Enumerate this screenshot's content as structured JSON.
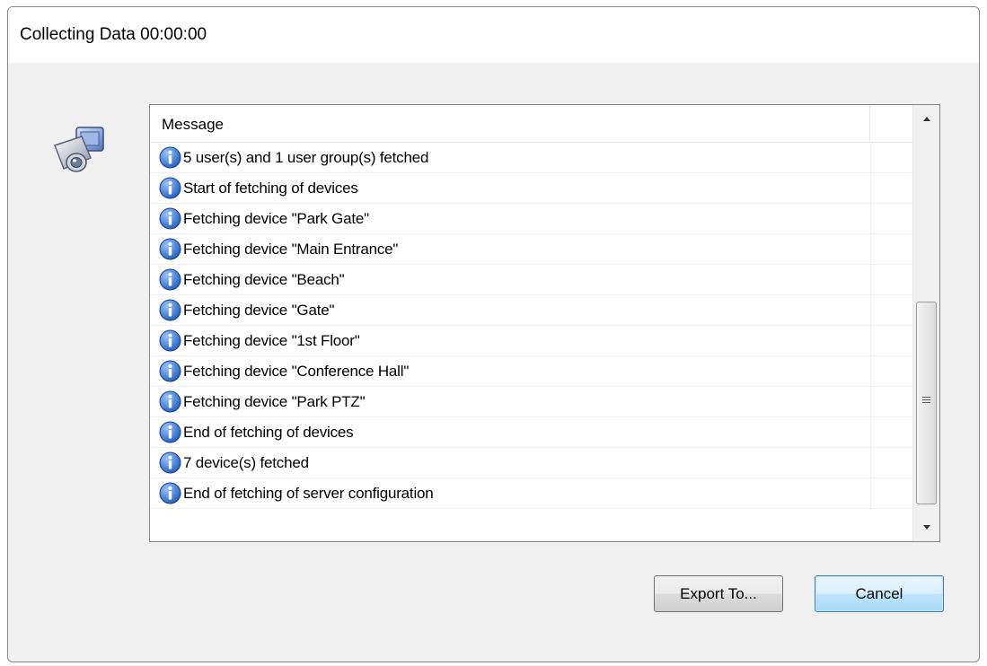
{
  "window": {
    "title": "Collecting Data 00:00:00"
  },
  "list": {
    "column_header": "Message",
    "rows": [
      {
        "icon": "info-icon",
        "text": "5 user(s) and 1 user group(s) fetched"
      },
      {
        "icon": "info-icon",
        "text": "Start of fetching of devices"
      },
      {
        "icon": "info-icon",
        "text": "Fetching device \"Park Gate\""
      },
      {
        "icon": "info-icon",
        "text": "Fetching device \"Main Entrance\""
      },
      {
        "icon": "info-icon",
        "text": "Fetching device \"Beach\""
      },
      {
        "icon": "info-icon",
        "text": "Fetching device \"Gate\""
      },
      {
        "icon": "info-icon",
        "text": "Fetching device \"1st Floor\""
      },
      {
        "icon": "info-icon",
        "text": "Fetching device \"Conference Hall\""
      },
      {
        "icon": "info-icon",
        "text": "Fetching device \"Park PTZ\""
      },
      {
        "icon": "info-icon",
        "text": "End of fetching of devices"
      },
      {
        "icon": "info-icon",
        "text": "7 device(s) fetched"
      },
      {
        "icon": "info-icon",
        "text": "End of fetching of server configuration"
      }
    ]
  },
  "buttons": {
    "export_label": "Export To...",
    "cancel_label": "Cancel"
  },
  "colors": {
    "info_icon": "#1f5fbf",
    "dialog_bg": "#f0f0f0",
    "focus_border": "#3c7fb1"
  }
}
